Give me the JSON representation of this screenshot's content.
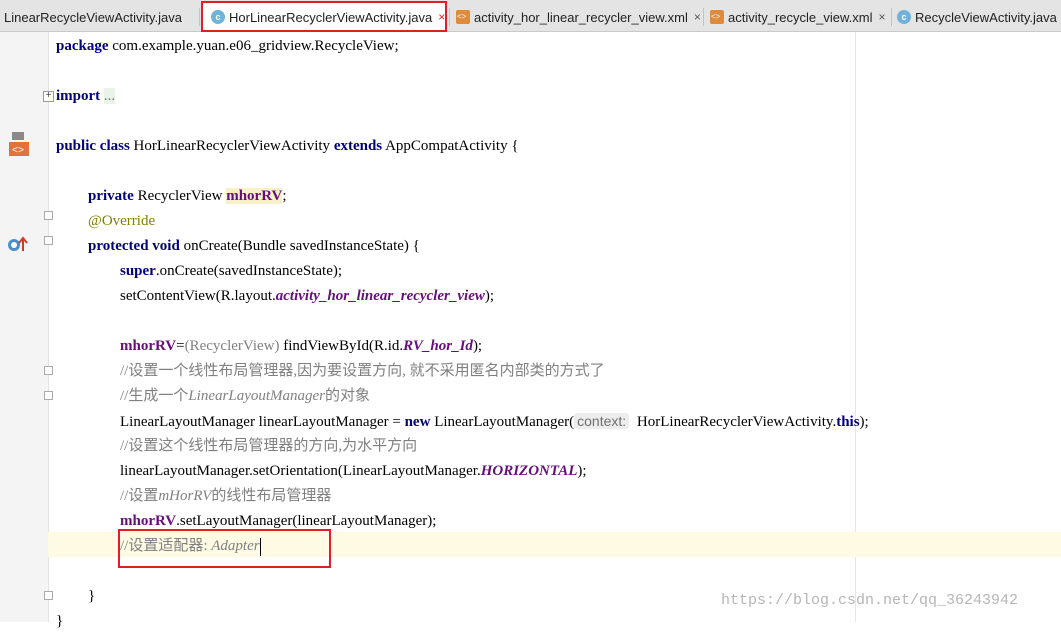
{
  "tabs": [
    {
      "label": "LinearRecycleViewActivity.java",
      "icon": "java-class-icon",
      "active": false
    },
    {
      "label": "HorLinearRecyclerViewActivity.java",
      "icon": "java-class-icon",
      "active": true
    },
    {
      "label": "activity_hor_linear_recycler_view.xml",
      "icon": "xml-layout-icon",
      "active": false
    },
    {
      "label": "activity_recycle_view.xml",
      "icon": "xml-layout-icon",
      "active": false
    },
    {
      "label": "RecycleViewActivity.java",
      "icon": "java-class-icon",
      "active": false
    }
  ],
  "tab_close_symbol": "×",
  "code": {
    "package_kw": "package",
    "package_name": " com.example.yuan.e06_gridview.RecycleView;",
    "import_kw": "import",
    "import_folded": "...",
    "class_decl": {
      "public": "public",
      "class": "class",
      "name": " HorLinearRecyclerViewActivity ",
      "extends": "extends",
      "parent": " AppCompatActivity {"
    },
    "field": {
      "private": "private",
      "type": " RecyclerView ",
      "name": "mhorRV",
      "end": ";"
    },
    "annotation": "@Override",
    "method": {
      "protected": "protected",
      "void": "void",
      "sig": " onCreate(Bundle savedInstanceState) {"
    },
    "super_line": {
      "super": "super",
      "rest": ".onCreate(savedInstanceState);"
    },
    "setcontent": {
      "pre": "setContentView(R.layout.",
      "ref": "activity_hor_linear_recycler_view",
      "post": ");"
    },
    "findview": {
      "var": "mhorRV",
      "eq": "=",
      "cast": "(RecyclerView)",
      "call": " findViewById(R.id.",
      "ref": "RV_hor_Id",
      "post": ");"
    },
    "comment1": "//设置一个线性布局管理器,因为要设置方向, 就不采用匿名内部类的方式了",
    "comment2_a": "//生成一个",
    "comment2_b": "LinearLayoutManager",
    "comment2_c": "的对象",
    "llm_line": {
      "pre": "LinearLayoutManager linearLayoutManager = ",
      "new": "new",
      "ctor": " LinearLayoutManager(",
      "hint": "context:",
      "arg": " HorLinearRecyclerViewActivity.",
      "this": "this",
      "post": ");"
    },
    "comment3": "//设置这个线性布局管理器的方向,为水平方向",
    "orient_line": {
      "pre": "linearLayoutManager.setOrientation(LinearLayoutManager.",
      "const": "HORIZONTAL",
      "post": ");"
    },
    "comment4_a": "//设置",
    "comment4_b": "mHorRV",
    "comment4_c": "的线性布局管理器",
    "setlm_line": {
      "var": "mhorRV",
      "rest": ".setLayoutManager(linearLayoutManager);"
    },
    "comment5_a": "//设置适配器: ",
    "comment5_b": "Adapter",
    "close_method": "}",
    "close_class": "}"
  },
  "watermark": "https://blog.csdn.net/qq_36243942"
}
